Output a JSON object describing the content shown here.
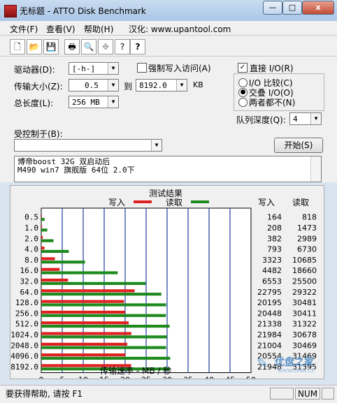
{
  "window": {
    "title": "无标题 - ATTO Disk Benchmark"
  },
  "window_buttons": {
    "minimize": "—",
    "maximize": "□",
    "close": "x"
  },
  "menu": [
    "文件(F)",
    "查看(V)",
    "帮助(H)",
    "汉化: www.upantool.com"
  ],
  "toolbar": {
    "icons": [
      "new-document-icon",
      "open-folder-icon",
      "save-icon",
      "print-icon",
      "print-preview-icon",
      "move-icon",
      "help-icon",
      "context-help-icon"
    ],
    "glyphs": [
      "🗋",
      "📂",
      "💾",
      "🖶",
      "🔍",
      "✥",
      "?",
      "?"
    ]
  },
  "form": {
    "drive_label": "驱动器(D):",
    "drive_value": "[-h-]",
    "transfer_label": "传输大小(Z):",
    "transfer_from": "0.5",
    "transfer_to_label": "到",
    "transfer_to": "8192.0",
    "transfer_unit": "KB",
    "total_label": "总长度(L):",
    "total_value": "256 MB",
    "force_write_label": "强制写入访问(A)",
    "direct_io_label": "直接 I/O(R)",
    "io_compare_label": "I/O 比较(C)",
    "overlapped_io_label": "交叠 I/O(O)",
    "neither_label": "两者都不(N)",
    "queue_label": "队列深度(Q):",
    "queue_value": "4",
    "controlled_label": "受控制于(B):",
    "controlled_value": "",
    "start_button": "开始(S)",
    "description_line1": "博帝boost 32G 双启动后",
    "description_line2": "M490 win7 旗舰版 64位 2.0下"
  },
  "results": {
    "title": "测试结果",
    "write_legend": "写入",
    "read_legend": "读取",
    "write_col": "写入",
    "read_col": "读取",
    "xlabel": "传输速率 - MB / 秒"
  },
  "chart_data": {
    "type": "bar",
    "orientation": "horizontal",
    "title": "测试结果",
    "xlabel": "传输速率 - MB / 秒",
    "xlim": [
      0,
      50
    ],
    "xticks": [
      0,
      5,
      10,
      15,
      20,
      25,
      30,
      35,
      40,
      45,
      50
    ],
    "categories": [
      "0.5",
      "1.0",
      "2.0",
      "4.0",
      "8.0",
      "16.0",
      "32.0",
      "64.0",
      "128.0",
      "256.0",
      "512.0",
      "1024.0",
      "2048.0",
      "4096.0",
      "8192.0"
    ],
    "series": [
      {
        "name": "写入",
        "color": "#dd2020",
        "values": [
          0.16,
          0.2,
          0.37,
          0.77,
          3.25,
          4.38,
          6.4,
          22.26,
          19.72,
          19.97,
          20.84,
          21.47,
          20.51,
          20.07,
          21.43
        ]
      },
      {
        "name": "读取",
        "color": "#1e8a1e",
        "values": [
          0.8,
          1.44,
          2.92,
          6.57,
          10.44,
          18.22,
          24.9,
          28.63,
          29.77,
          29.7,
          30.59,
          29.96,
          29.75,
          30.73,
          30.66
        ]
      }
    ],
    "write_values_text": [
      "164",
      "208",
      "382",
      "793",
      "3323",
      "4482",
      "6553",
      "22795",
      "20195",
      "20448",
      "21338",
      "21984",
      "21004",
      "20554",
      "21948"
    ],
    "read_values_text": [
      "818",
      "1473",
      "2989",
      "6730",
      "10685",
      "18660",
      "25500",
      "29322",
      "30481",
      "30411",
      "31322",
      "30678",
      "30469",
      "31469",
      "31395"
    ]
  },
  "watermark": {
    "text": "优盘之家",
    "sub": "WWW.UPAN.CC"
  },
  "status": {
    "help": "要获得帮助, 请按 F1",
    "num": "NUM"
  }
}
